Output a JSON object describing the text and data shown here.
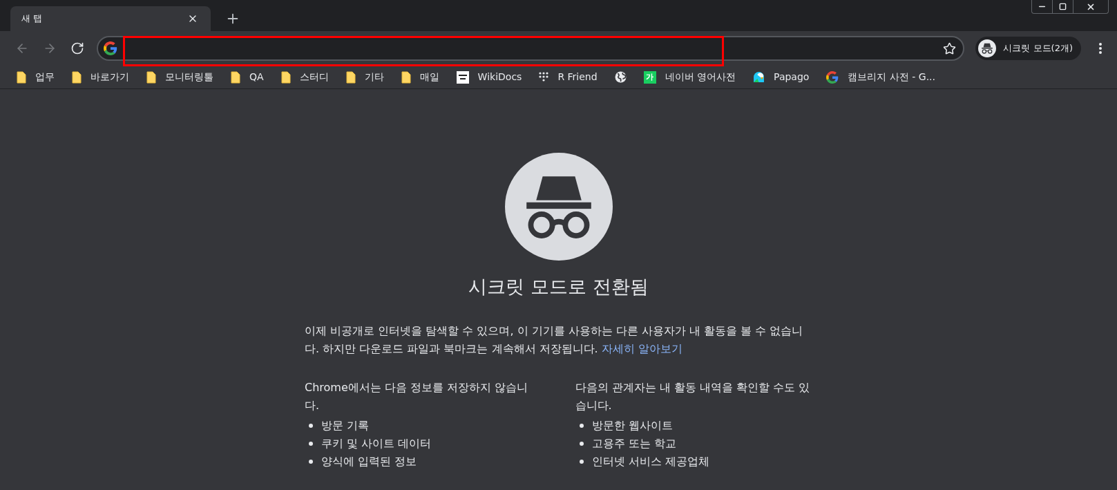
{
  "tabs": [
    {
      "title": "새 탭",
      "selected": true
    }
  ],
  "nav_buttons": [
    {
      "kind": "back",
      "disabled": true
    },
    {
      "kind": "forward",
      "disabled": true
    },
    {
      "kind": "reload",
      "disabled": false
    }
  ],
  "profile": {
    "label": "시크릿 모드(2개)"
  },
  "bookmarks": [
    {
      "kind": "folder",
      "label": "업무"
    },
    {
      "kind": "folder",
      "label": "바로가기"
    },
    {
      "kind": "folder",
      "label": "모니터링툴"
    },
    {
      "kind": "folder",
      "label": "QA"
    },
    {
      "kind": "folder",
      "label": "스터디"
    },
    {
      "kind": "folder",
      "label": "기타"
    },
    {
      "kind": "folder",
      "label": "매일"
    },
    {
      "kind": "wikidocs",
      "label": "WikiDocs"
    },
    {
      "kind": "dots",
      "label": "R Friend"
    },
    {
      "kind": "globe"
    },
    {
      "kind": "naver",
      "label": "네이버 영어사전",
      "icon_text": "가"
    },
    {
      "kind": "papago",
      "label": "Papago"
    },
    {
      "kind": "google",
      "label": "캠브리지 사전 - G..."
    }
  ],
  "page": {
    "title": "시크릿 모드로 전환됨",
    "description": "이제 비공개로 인터넷을 탐색할 수 있으며, 이 기기를 사용하는 다른 사용자가 내 활동을 볼 수 없습니다. 하지만 다운로드 파일과 북마크는 계속해서 저장됩니다.",
    "learn_more": "자세히 알아보기",
    "columns": [
      {
        "heading": "Chrome에서는 다음 정보를 저장하지 않습니다.",
        "items": [
          "방문 기록",
          "쿠키 및 사이트 데이터",
          "양식에 입력된 정보"
        ]
      },
      {
        "heading": "다음의 관계자는 내 활동 내역을 확인할 수도 있습니다.",
        "items": [
          "방문한 웹사이트",
          "고용주 또는 학교",
          "인터넷 서비스 제공업체"
        ]
      }
    ]
  }
}
